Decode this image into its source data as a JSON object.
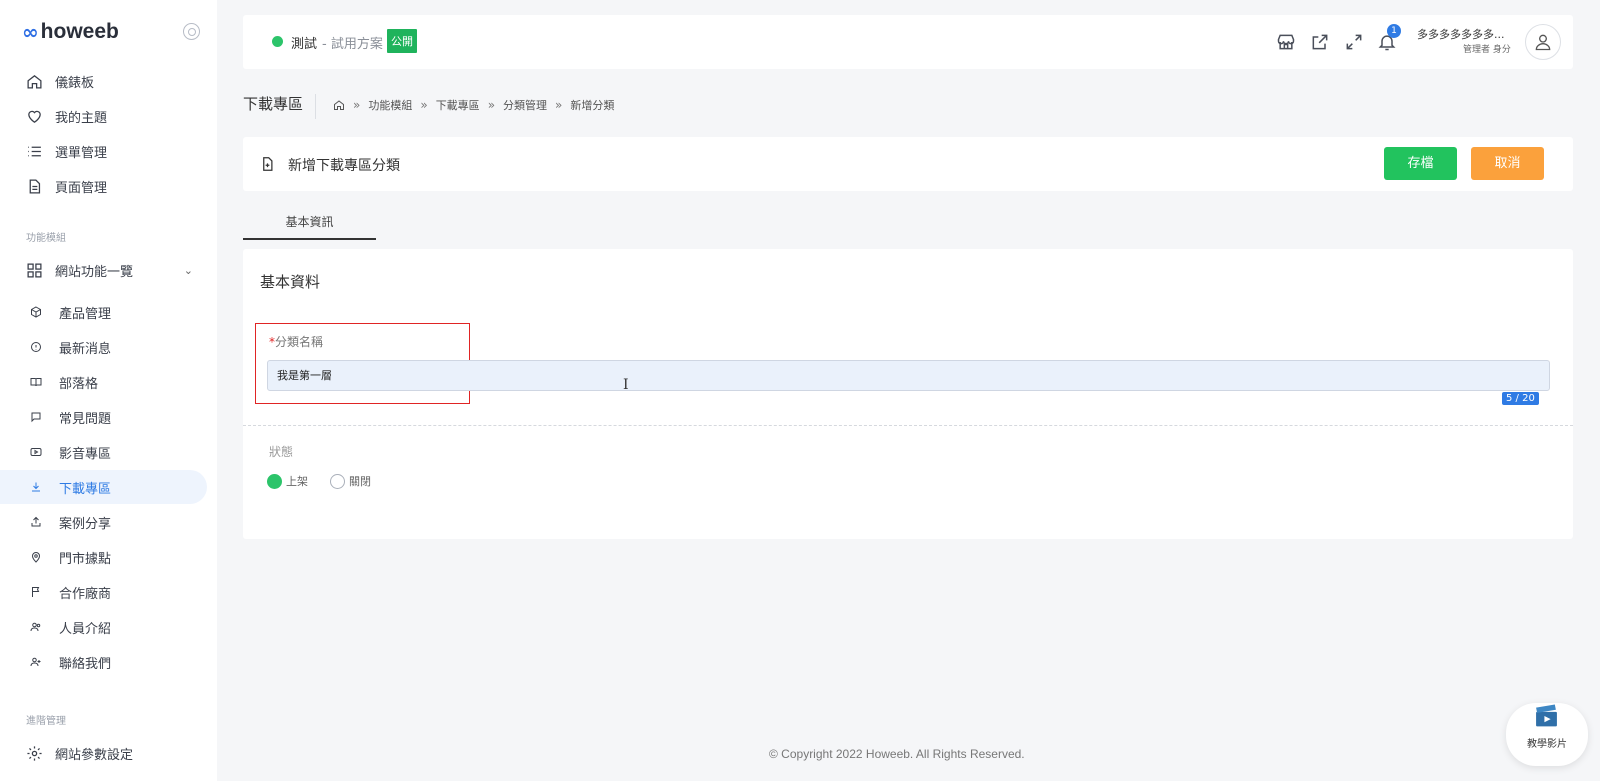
{
  "logo": {
    "mark": "∞",
    "word": "howeeb"
  },
  "sidebar": {
    "main_items": [
      {
        "label": "儀錶板",
        "icon": "home-icon"
      },
      {
        "label": "我的主題",
        "icon": "heart-icon"
      },
      {
        "label": "選單管理",
        "icon": "list-icon"
      },
      {
        "label": "頁面管理",
        "icon": "document-icon"
      }
    ],
    "section_modules": "功能模組",
    "site_functions": {
      "label": "網站功能一覽",
      "icon": "grid-icon"
    },
    "sub_items": [
      {
        "label": "產品管理",
        "icon": "box-icon"
      },
      {
        "label": "最新消息",
        "icon": "info-icon"
      },
      {
        "label": "部落格",
        "icon": "book-icon"
      },
      {
        "label": "常見問題",
        "icon": "chat-icon"
      },
      {
        "label": "影音專區",
        "icon": "video-icon"
      },
      {
        "label": "下載專區",
        "icon": "download-icon"
      },
      {
        "label": "案例分享",
        "icon": "share-icon"
      },
      {
        "label": "門市據點",
        "icon": "location-icon"
      },
      {
        "label": "合作廠商",
        "icon": "flag-icon"
      },
      {
        "label": "人員介紹",
        "icon": "people-icon"
      },
      {
        "label": "聯絡我們",
        "icon": "contact-icon"
      }
    ],
    "active_index": 5,
    "section_advanced": "進階管理",
    "settings_item": {
      "label": "網站參數設定",
      "icon": "gear-icon"
    }
  },
  "topbar": {
    "site_name": "測試",
    "site_plan": "- 試用方案",
    "public_badge": "公開",
    "notification_count": "1",
    "user_name": "多多多多多多多...",
    "user_role": "管理者 身分"
  },
  "breadcrumb": {
    "page_title": "下載專區",
    "items": [
      "功能模組",
      "下載專區",
      "分類管理",
      "新增分類"
    ]
  },
  "form": {
    "title": "新增下載專區分類",
    "save_label": "存檔",
    "cancel_label": "取消",
    "tab_label": "基本資訊",
    "card_title": "基本資料",
    "field_required_mark": "*",
    "field_label": "分類名稱",
    "field_value": "我是第一層",
    "counter": "5 / 20",
    "status_label": "狀態",
    "status_options": [
      "上架",
      "關閉"
    ],
    "status_selected": "上架"
  },
  "footer": "© Copyright 2022 Howeeb. All Rights Reserved.",
  "tutorial_label": "教學影片",
  "colors": {
    "accent_blue": "#2f7be4",
    "save_green": "#22c35e",
    "cancel_orange": "#fba13c",
    "status_green": "#2cc46a",
    "highlight_red": "#e02424"
  }
}
